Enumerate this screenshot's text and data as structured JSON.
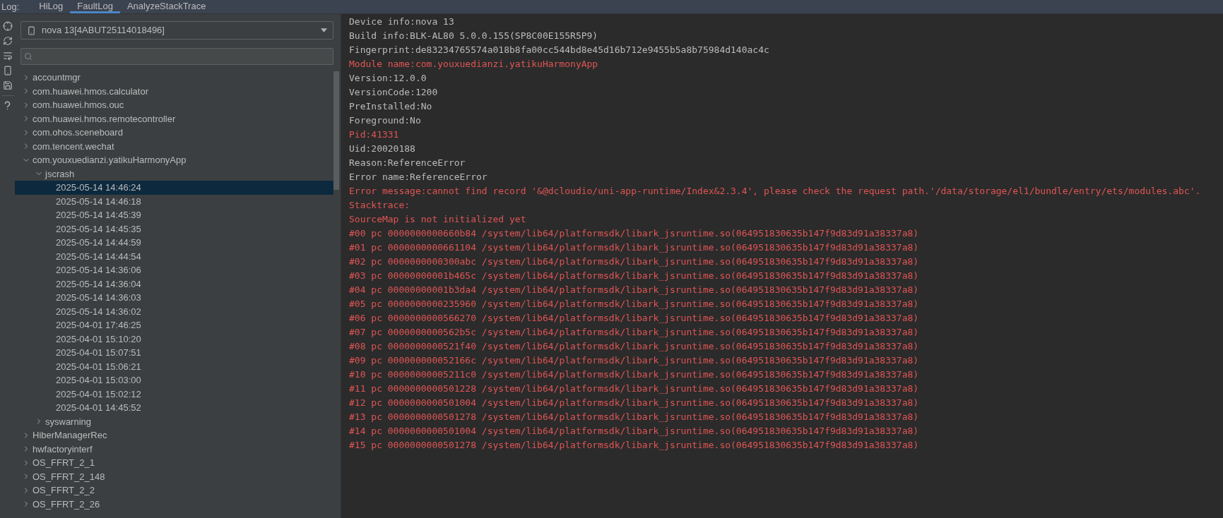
{
  "tabs_label": "Log:",
  "tabs": [
    {
      "label": "HiLog",
      "selected": false
    },
    {
      "label": "FaultLog",
      "selected": true
    },
    {
      "label": "AnalyzeStackTrace",
      "selected": false
    }
  ],
  "device_select": {
    "value": "nova 13[4ABUT25114018496]"
  },
  "tree": [
    {
      "label": "accountmgr",
      "expanded": false,
      "selected": false
    },
    {
      "label": "com.huawei.hmos.calculator",
      "expanded": false,
      "selected": false
    },
    {
      "label": "com.huawei.hmos.ouc",
      "expanded": false,
      "selected": false
    },
    {
      "label": "com.huawei.hmos.remotecontroller",
      "expanded": false,
      "selected": false
    },
    {
      "label": "com.ohos.sceneboard",
      "expanded": false,
      "selected": false
    },
    {
      "label": "com.tencent.wechat",
      "expanded": false,
      "selected": false
    },
    {
      "label": "com.youxuedianzi.yatikuHarmonyApp",
      "expanded": true,
      "selected": false,
      "children": [
        {
          "label": "jscrash",
          "expanded": true,
          "selected": false,
          "children": [
            {
              "label": "2025-05-14 14:46:24",
              "selected": true
            },
            {
              "label": "2025-05-14 14:46:18",
              "selected": false
            },
            {
              "label": "2025-05-14 14:45:39",
              "selected": false
            },
            {
              "label": "2025-05-14 14:45:35",
              "selected": false
            },
            {
              "label": "2025-05-14 14:44:59",
              "selected": false
            },
            {
              "label": "2025-05-14 14:44:54",
              "selected": false
            },
            {
              "label": "2025-05-14 14:36:06",
              "selected": false
            },
            {
              "label": "2025-05-14 14:36:04",
              "selected": false
            },
            {
              "label": "2025-05-14 14:36:03",
              "selected": false
            },
            {
              "label": "2025-05-14 14:36:02",
              "selected": false
            },
            {
              "label": "2025-04-01 17:46:25",
              "selected": false
            },
            {
              "label": "2025-04-01 15:10:20",
              "selected": false
            },
            {
              "label": "2025-04-01 15:07:51",
              "selected": false
            },
            {
              "label": "2025-04-01 15:06:21",
              "selected": false
            },
            {
              "label": "2025-04-01 15:03:00",
              "selected": false
            },
            {
              "label": "2025-04-01 15:02:12",
              "selected": false
            },
            {
              "label": "2025-04-01 14:45:52",
              "selected": false
            }
          ]
        },
        {
          "label": "syswarning",
          "expanded": false,
          "selected": false
        }
      ]
    },
    {
      "label": "HiberManagerRec",
      "expanded": false,
      "selected": false
    },
    {
      "label": "hwfactoryinterf",
      "expanded": false,
      "selected": false
    },
    {
      "label": "OS_FFRT_2_1",
      "expanded": false,
      "selected": false
    },
    {
      "label": "OS_FFRT_2_148",
      "expanded": false,
      "selected": false
    },
    {
      "label": "OS_FFRT_2_2",
      "expanded": false,
      "selected": false
    },
    {
      "label": "OS_FFRT_2_26",
      "expanded": false,
      "selected": false
    }
  ],
  "log_lines": [
    {
      "kind": "info",
      "text": "Device info:nova 13"
    },
    {
      "kind": "info",
      "text": "Build info:BLK-AL80 5.0.0.155(SP8C00E155R5P9)"
    },
    {
      "kind": "info",
      "text": "Fingerprint:de83234765574a018b8fa00cc544bd8e45d16b712e9455b5a8b75984d140ac4c"
    },
    {
      "kind": "error",
      "text": "Module name:com.youxuedianzi.yatikuHarmonyApp"
    },
    {
      "kind": "info",
      "text": "Version:12.0.0"
    },
    {
      "kind": "info",
      "text": "VersionCode:1200"
    },
    {
      "kind": "info",
      "text": "PreInstalled:No"
    },
    {
      "kind": "info",
      "text": "Foreground:No"
    },
    {
      "kind": "error",
      "text": "Pid:41331"
    },
    {
      "kind": "info",
      "text": "Uid:20020188"
    },
    {
      "kind": "info",
      "text": "Reason:ReferenceError"
    },
    {
      "kind": "info",
      "text": "Error name:ReferenceError"
    },
    {
      "kind": "error",
      "text": "Error message:cannot find record '&@dcloudio/uni-app-runtime/Index&2.3.4', please check the request path.'/data/storage/el1/bundle/entry/ets/modules.abc'."
    },
    {
      "kind": "error",
      "text": "Stacktrace:"
    },
    {
      "kind": "error",
      "text": "SourceMap is not initialized yet"
    },
    {
      "kind": "error",
      "text": "#00 pc 0000000000660b84 /system/lib64/platformsdk/libark_jsruntime.so(064951830635b147f9d83d91a38337a8)"
    },
    {
      "kind": "error",
      "text": "#01 pc 0000000000661104 /system/lib64/platformsdk/libark_jsruntime.so(064951830635b147f9d83d91a38337a8)"
    },
    {
      "kind": "error",
      "text": "#02 pc 0000000000300abc /system/lib64/platformsdk/libark_jsruntime.so(064951830635b147f9d83d91a38337a8)"
    },
    {
      "kind": "error",
      "text": "#03 pc 00000000001b465c /system/lib64/platformsdk/libark_jsruntime.so(064951830635b147f9d83d91a38337a8)"
    },
    {
      "kind": "error",
      "text": "#04 pc 00000000001b3da4 /system/lib64/platformsdk/libark_jsruntime.so(064951830635b147f9d83d91a38337a8)"
    },
    {
      "kind": "error",
      "text": "#05 pc 0000000000235960 /system/lib64/platformsdk/libark_jsruntime.so(064951830635b147f9d83d91a38337a8)"
    },
    {
      "kind": "error",
      "text": "#06 pc 0000000000566270 /system/lib64/platformsdk/libark_jsruntime.so(064951830635b147f9d83d91a38337a8)"
    },
    {
      "kind": "error",
      "text": "#07 pc 0000000000562b5c /system/lib64/platformsdk/libark_jsruntime.so(064951830635b147f9d83d91a38337a8)"
    },
    {
      "kind": "error",
      "text": "#08 pc 0000000000521f40 /system/lib64/platformsdk/libark_jsruntime.so(064951830635b147f9d83d91a38337a8)"
    },
    {
      "kind": "error",
      "text": "#09 pc 000000000052166c /system/lib64/platformsdk/libark_jsruntime.so(064951830635b147f9d83d91a38337a8)"
    },
    {
      "kind": "error",
      "text": "#10 pc 00000000005211c0 /system/lib64/platformsdk/libark_jsruntime.so(064951830635b147f9d83d91a38337a8)"
    },
    {
      "kind": "error",
      "text": "#11 pc 0000000000501228 /system/lib64/platformsdk/libark_jsruntime.so(064951830635b147f9d83d91a38337a8)"
    },
    {
      "kind": "error",
      "text": "#12 pc 0000000000501004 /system/lib64/platformsdk/libark_jsruntime.so(064951830635b147f9d83d91a38337a8)"
    },
    {
      "kind": "error",
      "text": "#13 pc 0000000000501278 /system/lib64/platformsdk/libark_jsruntime.so(064951830635b147f9d83d91a38337a8)"
    },
    {
      "kind": "error",
      "text": "#14 pc 0000000000501004 /system/lib64/platformsdk/libark_jsruntime.so(064951830635b147f9d83d91a38337a8)"
    },
    {
      "kind": "error",
      "text": "#15 pc 0000000000501278 /system/lib64/platformsdk/libark_jsruntime.so(064951830635b147f9d83d91a38337a8)"
    }
  ]
}
